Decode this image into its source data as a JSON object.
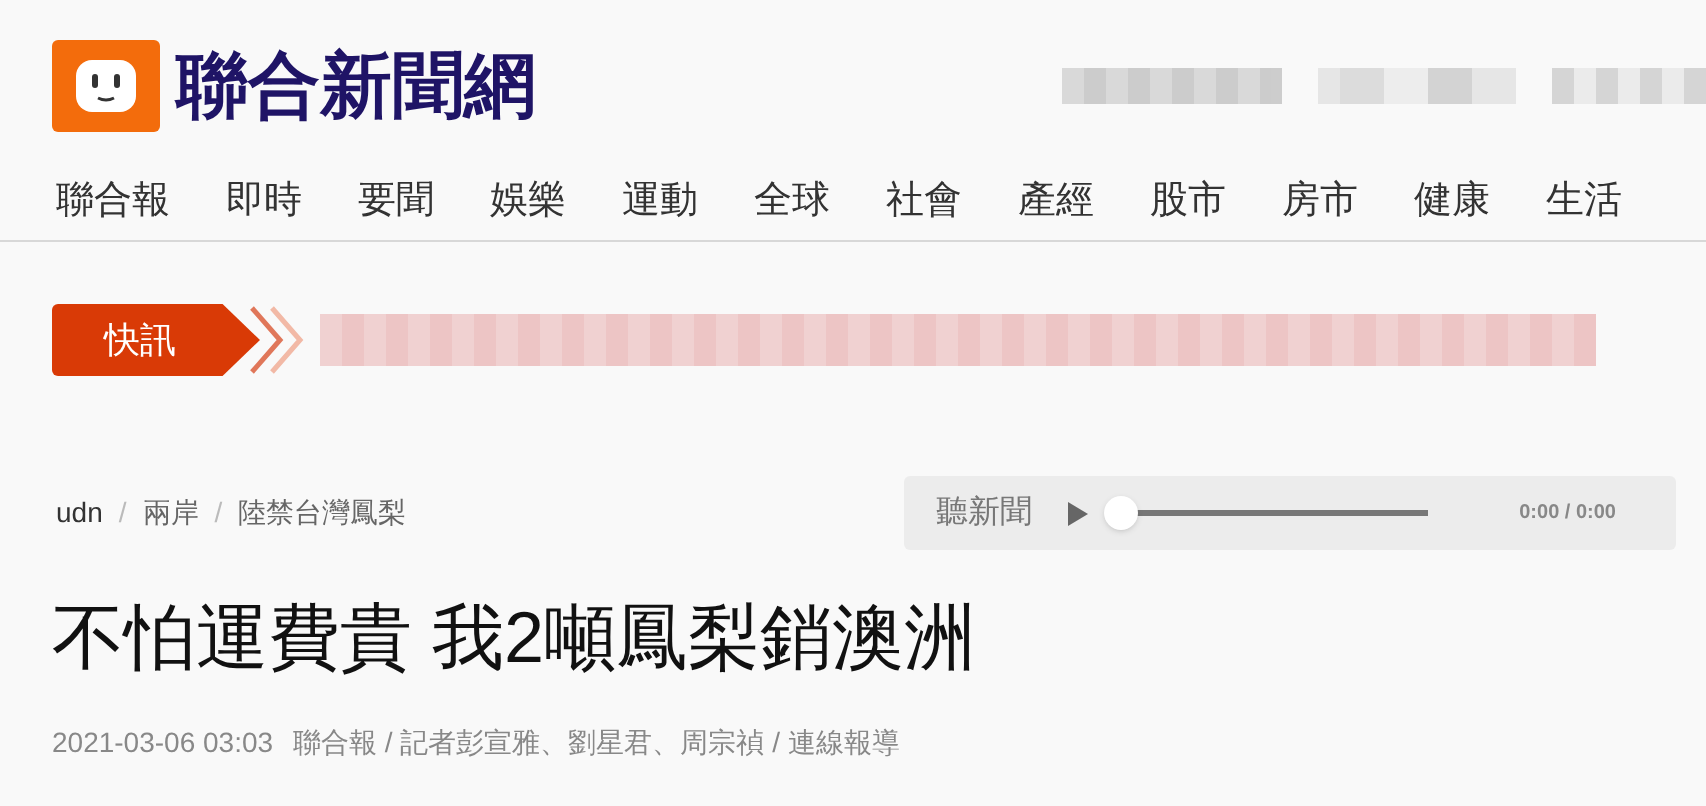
{
  "site": {
    "name": "聯合新聞網"
  },
  "nav": [
    {
      "label": "聯合報"
    },
    {
      "label": "即時"
    },
    {
      "label": "要聞"
    },
    {
      "label": "娛樂"
    },
    {
      "label": "運動"
    },
    {
      "label": "全球"
    },
    {
      "label": "社會"
    },
    {
      "label": "產經"
    },
    {
      "label": "股市"
    },
    {
      "label": "房市"
    },
    {
      "label": "健康"
    },
    {
      "label": "生活"
    }
  ],
  "ticker": {
    "label": "快訊"
  },
  "breadcrumb": {
    "separator": "/",
    "items": [
      "udn",
      "兩岸",
      "陸禁台灣鳳梨"
    ]
  },
  "player": {
    "label": "聽新聞",
    "level": 0,
    "time": "0:00 / 0:00"
  },
  "article": {
    "title": "不怕運費貴 我2噸鳳梨銷澳洲",
    "date": "2021-03-06 03:03",
    "byline": "聯合報 / 記者彭宣雅、劉星君、周宗禎 / 連線報導"
  }
}
